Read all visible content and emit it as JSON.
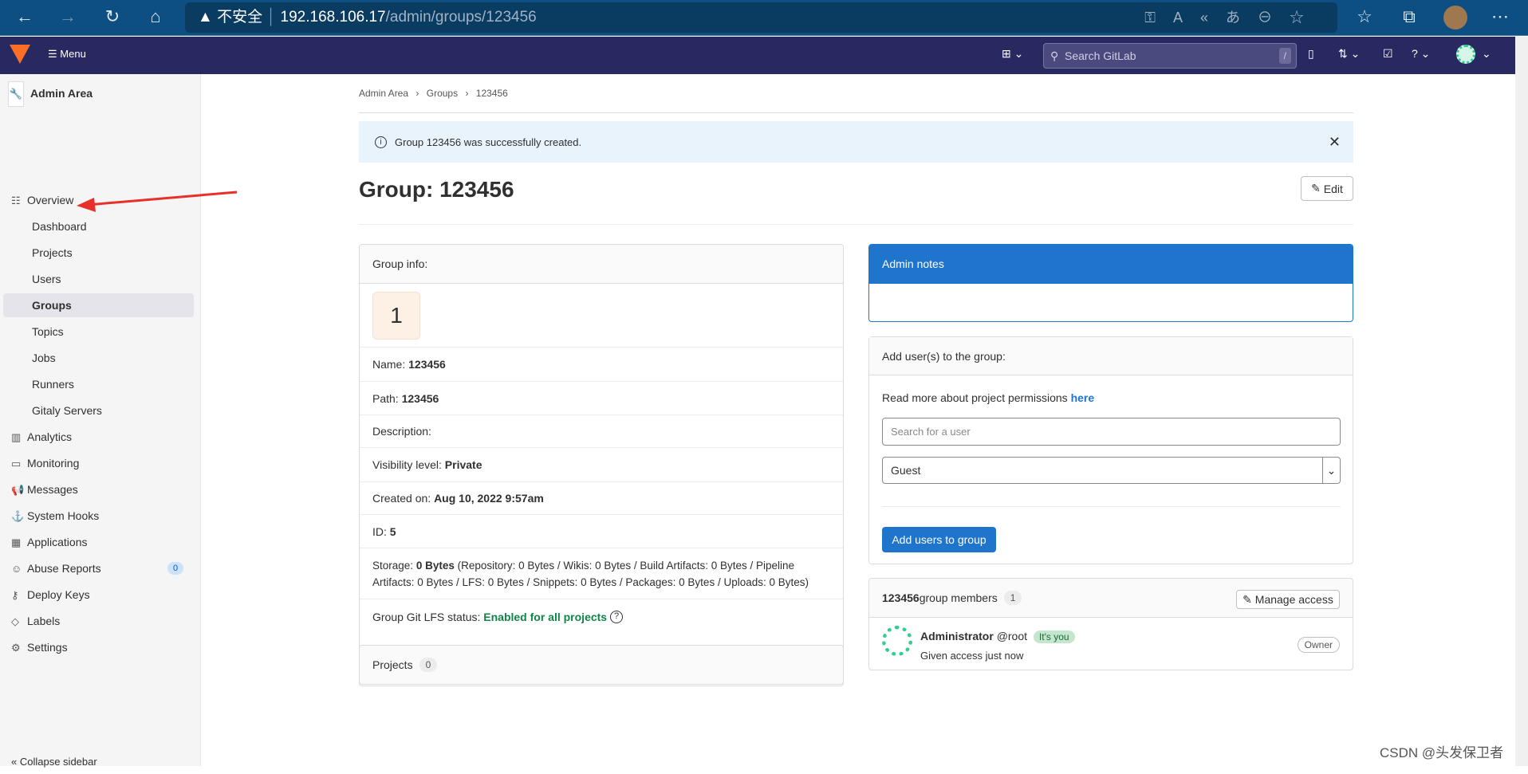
{
  "browser": {
    "security": "不安全",
    "url_host": "192.168.106.17",
    "url_path": "/admin/groups/123456"
  },
  "topbar": {
    "menu": "Menu",
    "search_placeholder": "Search GitLab",
    "search_shortcut": "/"
  },
  "sidebar": {
    "title": "Admin Area",
    "items": [
      {
        "label": "Overview",
        "icon": "overview-icon",
        "level": 0
      },
      {
        "label": "Dashboard",
        "level": 1
      },
      {
        "label": "Projects",
        "level": 1
      },
      {
        "label": "Users",
        "level": 1
      },
      {
        "label": "Groups",
        "level": 1,
        "active": true
      },
      {
        "label": "Topics",
        "level": 1
      },
      {
        "label": "Jobs",
        "level": 1
      },
      {
        "label": "Runners",
        "level": 1
      },
      {
        "label": "Gitaly Servers",
        "level": 1
      },
      {
        "label": "Analytics",
        "icon": "chart-icon",
        "level": 0
      },
      {
        "label": "Monitoring",
        "icon": "monitor-icon",
        "level": 0
      },
      {
        "label": "Messages",
        "icon": "bullhorn-icon",
        "level": 0
      },
      {
        "label": "System Hooks",
        "icon": "anchor-icon",
        "level": 0
      },
      {
        "label": "Applications",
        "icon": "grid-icon",
        "level": 0
      },
      {
        "label": "Abuse Reports",
        "icon": "face-icon",
        "level": 0,
        "badge": "0"
      },
      {
        "label": "Deploy Keys",
        "icon": "key-icon",
        "level": 0
      },
      {
        "label": "Labels",
        "icon": "label-icon",
        "level": 0
      },
      {
        "label": "Settings",
        "icon": "gear-icon",
        "level": 0
      }
    ],
    "collapse": "Collapse sidebar"
  },
  "breadcrumb": [
    "Admin Area",
    "Groups",
    "123456"
  ],
  "alert": "Group 123456 was successfully created.",
  "title": "Group: 123456",
  "edit": "Edit",
  "info": {
    "header": "Group info:",
    "avatar_letter": "1",
    "name_label": "Name:",
    "name": "123456",
    "path_label": "Path:",
    "path": "123456",
    "desc_label": "Description:",
    "vis_label": "Visibility level:",
    "vis": "Private",
    "created_label": "Created on:",
    "created": "Aug 10, 2022 9:57am",
    "id_label": "ID:",
    "id": "5",
    "storage_label": "Storage:",
    "storage": "0 Bytes",
    "storage_detail": "(Repository: 0 Bytes / Wikis: 0 Bytes / Build Artifacts: 0 Bytes / Pipeline Artifacts: 0 Bytes / LFS: 0 Bytes / Snippets: 0 Bytes / Packages: 0 Bytes / Uploads: 0 Bytes)",
    "lfs_label": "Group Git LFS status:",
    "lfs": "Enabled for all projects"
  },
  "projects": {
    "label": "Projects",
    "count": "0"
  },
  "admin_notes": "Admin notes",
  "add_users": {
    "header": "Add user(s) to the group:",
    "read_more": "Read more about project permissions ",
    "here": "here",
    "search_placeholder": "Search for a user",
    "role": "Guest",
    "button": "Add users to group"
  },
  "members": {
    "group": "123456",
    "label": " group members",
    "count": "1",
    "manage": "Manage access",
    "list": [
      {
        "name": "Administrator",
        "username": "@root",
        "badge": "It's you",
        "note": "Given access just now",
        "role": "Owner"
      }
    ]
  },
  "watermark": "CSDN @头发保卫者",
  "colors": {
    "topbar": "#292961",
    "primary": "#1f75cb",
    "success": "#108548"
  }
}
